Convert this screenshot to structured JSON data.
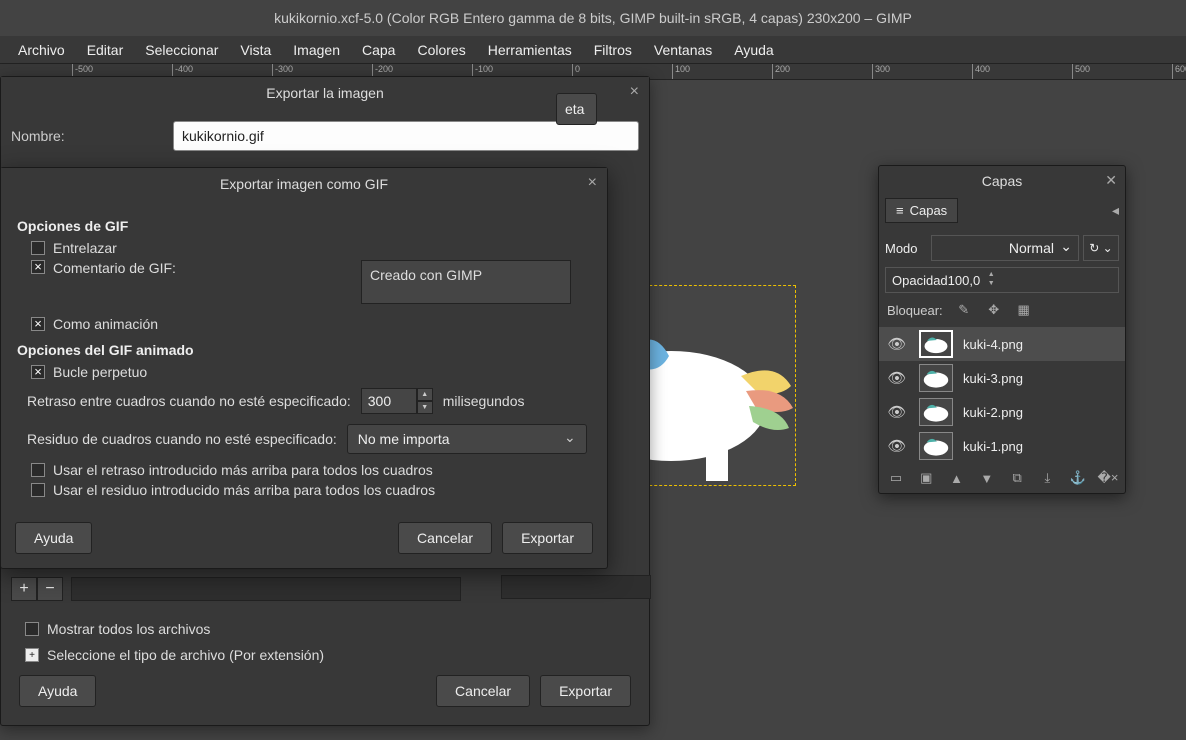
{
  "titlebar": "kukikornio.xcf-5.0 (Color RGB Entero gamma de 8 bits, GIMP built-in sRGB, 4 capas) 230x200 – GIMP",
  "menu": {
    "archivo": "Archivo",
    "editar": "Editar",
    "seleccionar": "Seleccionar",
    "vista": "Vista",
    "imagen": "Imagen",
    "capa": "Capa",
    "colores": "Colores",
    "herramientas": "Herramientas",
    "filtros": "Filtros",
    "ventanas": "Ventanas",
    "ayuda": "Ayuda"
  },
  "ruler_ticks": [
    "-500",
    "-400",
    "-300",
    "-200",
    "-100",
    "0",
    "100",
    "200",
    "300",
    "400",
    "500",
    "600"
  ],
  "export_dialog": {
    "title": "Exportar la imagen",
    "name_label": "Nombre:",
    "name_value": "kukikornio.gif",
    "carpeta": "eta",
    "show_all": "Mostrar todos los archivos",
    "select_type": "Seleccione el tipo de archivo (Por extensión)",
    "help": "Ayuda",
    "cancel": "Cancelar",
    "export": "Exportar"
  },
  "gif_dialog": {
    "title": "Exportar imagen como GIF",
    "section1": "Opciones de GIF",
    "interlace": "Entrelazar",
    "comment_label": "Comentario de GIF:",
    "comment_value": "Creado con GIMP",
    "as_animation": "Como animación",
    "section2": "Opciones del GIF animado",
    "loop": "Bucle perpetuo",
    "delay_label": "Retraso entre cuadros cuando no esté especificado:",
    "delay_value": "300",
    "delay_unit": "milisegundos",
    "disposal_label": "Residuo de cuadros cuando no esté especificado:",
    "disposal_value": "No me importa",
    "use_delay_all": "Usar el retraso introducido más arriba para todos los cuadros",
    "use_disposal_all": "Usar el residuo introducido más arriba para todos los cuadros",
    "help": "Ayuda",
    "cancel": "Cancelar",
    "export": "Exportar"
  },
  "layers": {
    "title": "Capas",
    "tab": "Capas",
    "mode_label": "Modo",
    "mode_value": "Normal",
    "opacity_label": "Opacidad",
    "opacity_value": "100,0",
    "lock_label": "Bloquear:",
    "items": [
      {
        "name": "kuki-4.png"
      },
      {
        "name": "kuki-3.png"
      },
      {
        "name": "kuki-2.png"
      },
      {
        "name": "kuki-1.png"
      }
    ]
  }
}
